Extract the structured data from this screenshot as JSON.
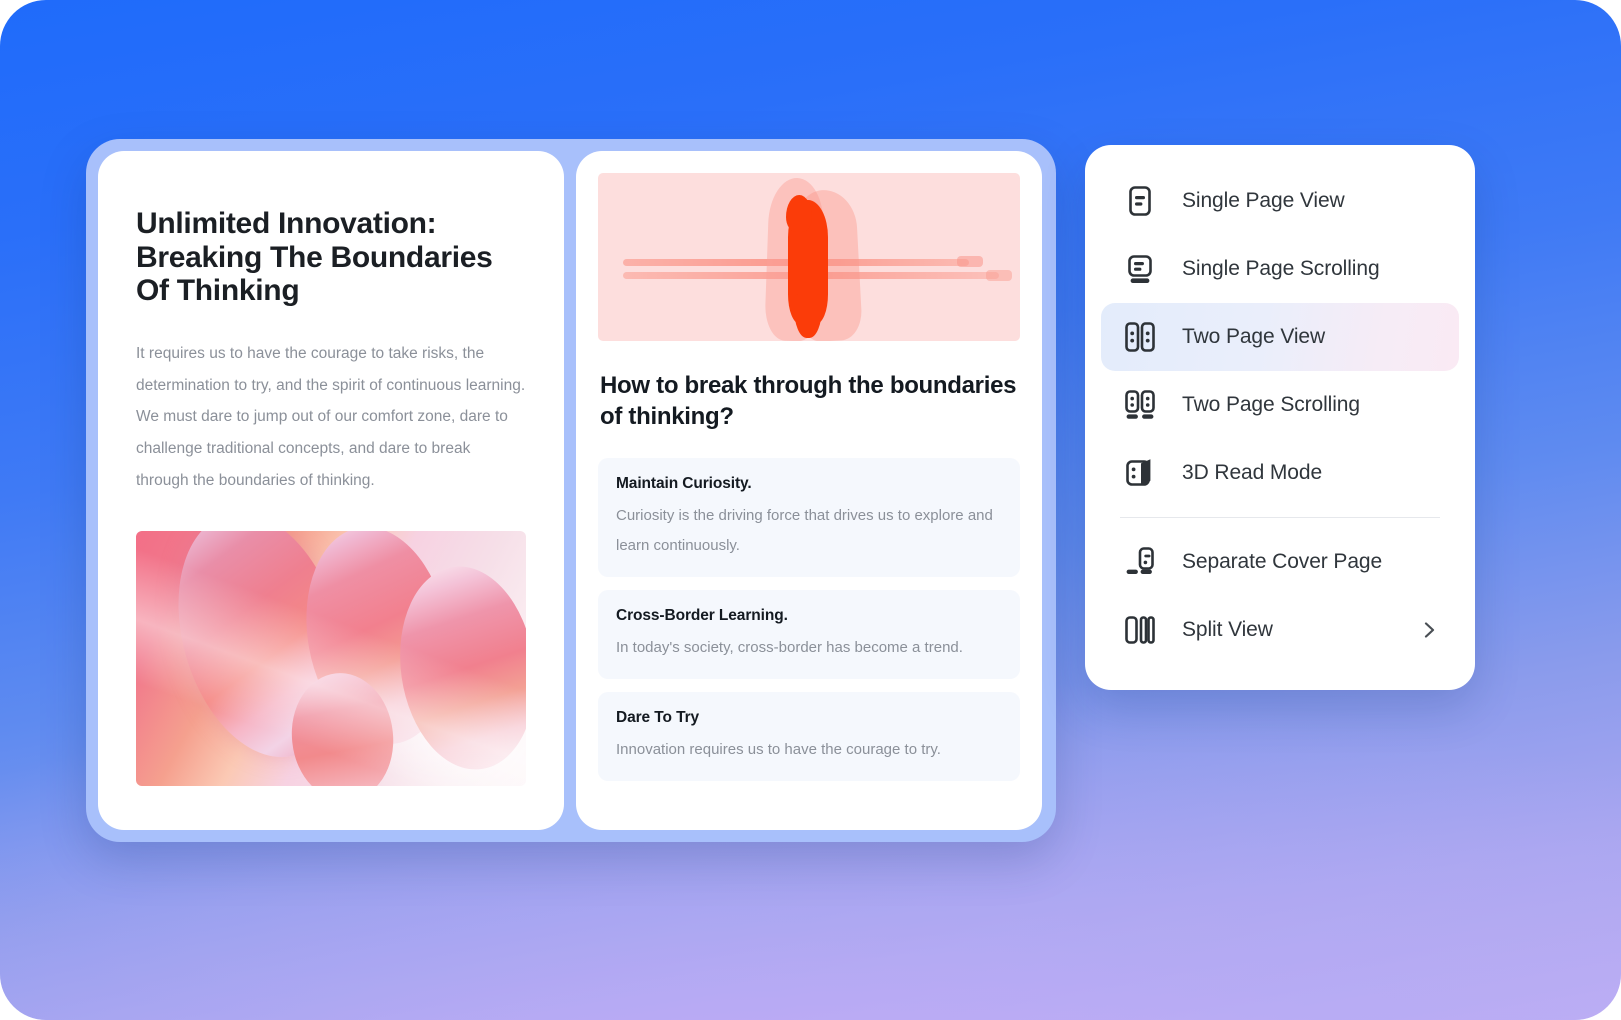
{
  "background": {
    "gradient_top": "#1f6bfa",
    "gradient_bottom": "#bdaef3",
    "frame_color": "#a8c0fb"
  },
  "article_card": {
    "title": "Unlimited Innovation: Breaking The Boundaries Of Thinking",
    "body": "It requires us to have the courage to take risks, the determination to try, and the spirit of continuous learning. We must dare to jump out of our comfort zone, dare to challenge traditional concepts, and dare to break through the boundaries of thinking.",
    "image_name": "pink-ribbon-abstract-image"
  },
  "qa_card": {
    "image_name": "orange-birds-on-wire-image",
    "title": "How to break through the boundaries of thinking?",
    "items": [
      {
        "title": "Maintain Curiosity.",
        "text": "Curiosity is the driving force that drives us to explore and learn continuously."
      },
      {
        "title": "Cross-Border Learning.",
        "text": "In today's society, cross-border has become a trend."
      },
      {
        "title": "Dare To Try",
        "text": "Innovation requires us to have the courage to try."
      }
    ]
  },
  "menu_card": {
    "active_item": "Two Page View",
    "highlight_gradient_start": "#e3ecfb",
    "highlight_gradient_end": "#faeaf4",
    "items": [
      {
        "label": "Single Page View",
        "icon": "single-page-view-icon",
        "active": false,
        "chevron": false
      },
      {
        "label": "Single Page Scrolling",
        "icon": "single-page-scrolling-icon",
        "active": false,
        "chevron": false
      },
      {
        "label": "Two Page View",
        "icon": "two-page-view-icon",
        "active": true,
        "chevron": false
      },
      {
        "label": "Two Page Scrolling",
        "icon": "two-page-scrolling-icon",
        "active": false,
        "chevron": false
      },
      {
        "label": "3D Read Mode",
        "icon": "three-d-read-mode-icon",
        "active": false,
        "chevron": false
      },
      {
        "label": "Separate Cover Page",
        "icon": "separate-cover-page-icon",
        "active": false,
        "chevron": false
      },
      {
        "label": "Split View",
        "icon": "split-view-icon",
        "active": false,
        "chevron": true
      }
    ]
  }
}
